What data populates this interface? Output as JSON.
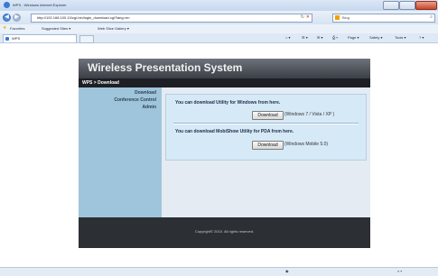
{
  "browser": {
    "title": "WPS - Windows Internet Explorer",
    "url": "http://192.168.100.10/cgi-bin/login_download.cgi?lang=en",
    "search_placeholder": "Bing",
    "favorites_label": "Favorites",
    "fav_items": [
      "Suggested Sites ▾",
      "Web Slice Gallery ▾"
    ],
    "tab_label": "WPS",
    "commands": [
      "Page ▾",
      "Safety ▾",
      "Tools ▾"
    ]
  },
  "app": {
    "title": "Wireless Presentation System",
    "breadcrumb": "WPS > Download",
    "sidebar": [
      "Download",
      "Conference Control",
      "Admin"
    ],
    "windows_text": "You can download Utility for Windows from here.",
    "windows_button": "Download",
    "windows_note": "(Windows 7 / Vista / XP )",
    "pda_text": "You can download MobiShow Utility for PDA from here.",
    "pda_button": "Download",
    "pda_note": "(Windows Mobile 5.0)",
    "copyright": "Copyright© 2010. All rights reserved."
  }
}
